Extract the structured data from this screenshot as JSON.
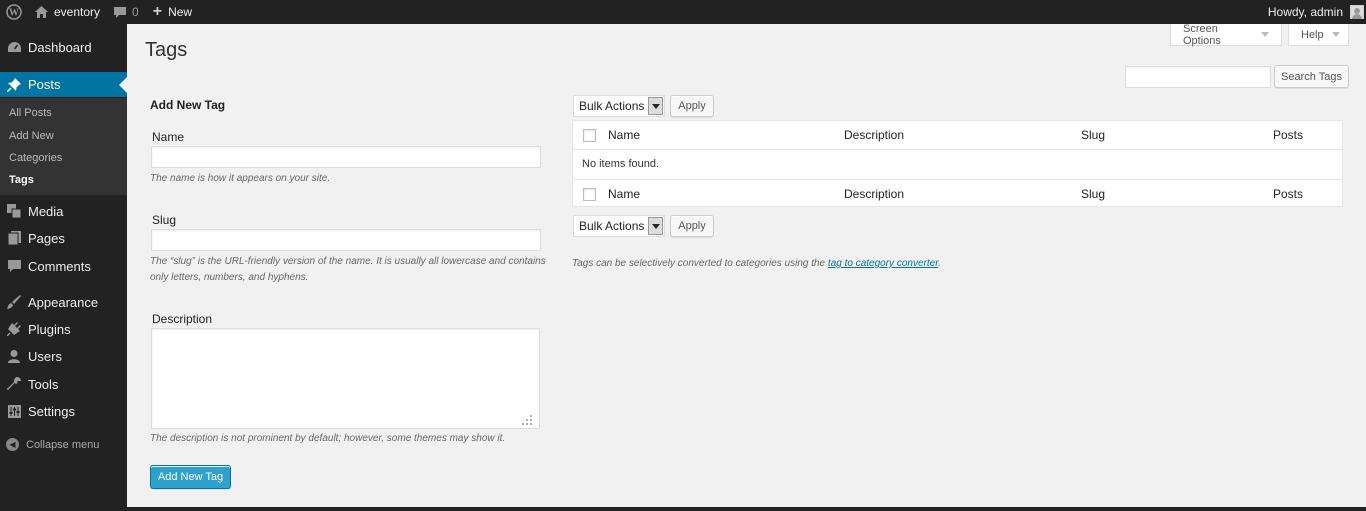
{
  "adminbar": {
    "site_name": "eventory",
    "comments_count": "0",
    "new_label": "New",
    "greeting": "Howdy, admin"
  },
  "sidebar": {
    "items": [
      {
        "label": "Dashboard",
        "icon": "dashboard-icon"
      },
      {
        "label": "Posts",
        "icon": "pushpin-icon"
      },
      {
        "label": "Media",
        "icon": "media-icon"
      },
      {
        "label": "Pages",
        "icon": "pages-icon"
      },
      {
        "label": "Comments",
        "icon": "comment-icon"
      },
      {
        "label": "Appearance",
        "icon": "paintbrush-icon"
      },
      {
        "label": "Plugins",
        "icon": "plugin-icon"
      },
      {
        "label": "Users",
        "icon": "user-icon"
      },
      {
        "label": "Tools",
        "icon": "wrench-icon"
      },
      {
        "label": "Settings",
        "icon": "settings-icon"
      }
    ],
    "posts_submenu": [
      "All Posts",
      "Add New",
      "Categories",
      "Tags"
    ],
    "collapse_label": "Collapse menu"
  },
  "header": {
    "title": "Tags",
    "screen_options": "Screen Options",
    "help": "Help"
  },
  "search": {
    "value": "",
    "button": "Search Tags"
  },
  "form": {
    "heading": "Add New Tag",
    "name_label": "Name",
    "name_value": "",
    "name_hint": "The name is how it appears on your site.",
    "slug_label": "Slug",
    "slug_value": "",
    "slug_hint_1": "The “slug” is the URL-friendly version of the name. It is usually all lowercase and contains",
    "slug_hint_2": "only letters, numbers, and hyphens.",
    "description_label": "Description",
    "description_value": "",
    "description_hint": "The description is not prominent by default; however, some themes may show it.",
    "submit": "Add New Tag"
  },
  "table": {
    "bulk_actions": "Bulk Actions",
    "apply": "Apply",
    "columns": [
      "Name",
      "Description",
      "Slug",
      "Posts"
    ],
    "empty_message": "No items found.",
    "note_prefix": "Tags can be selectively converted to categories using the ",
    "note_link": "tag to category converter",
    "note_suffix": "."
  },
  "colors": {
    "adminbar_bg": "#222222",
    "sidebar_bg": "#222222",
    "current_menu": "#0074a2",
    "primary_button": "#2ea2cc",
    "page_bg": "#f1f1f1"
  }
}
